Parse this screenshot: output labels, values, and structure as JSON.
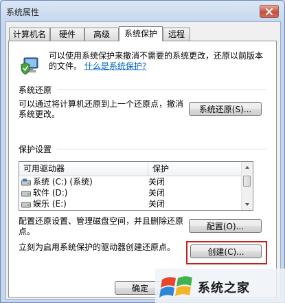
{
  "window": {
    "title": "系统属性"
  },
  "tabs": [
    {
      "label": "计算机名"
    },
    {
      "label": "硬件"
    },
    {
      "label": "高级"
    },
    {
      "label": "系统保护"
    },
    {
      "label": "远程"
    }
  ],
  "intro": {
    "text": "可以使用系统保护来撤消不需要的系统更改，还原以前版本的文件。",
    "link": "什么是系统保护?",
    "icon": "computer-shield-icon"
  },
  "restore": {
    "section": "系统还原",
    "description": "可以通过将计算机还原到上一个还原点，撤消系统更改。",
    "button": "系统还原(S)..."
  },
  "protection": {
    "section": "保护设置",
    "columns": [
      "可用驱动器",
      "保护"
    ],
    "rows": [
      {
        "drive": "系统 (C:) (系统)",
        "status": "关闭",
        "icon": "system-drive-icon"
      },
      {
        "drive": "软件 (D:)",
        "status": "关闭",
        "icon": "drive-icon"
      },
      {
        "drive": "娱乐 (E:)",
        "status": "关闭",
        "icon": "drive-icon"
      }
    ],
    "configure_text": "配置还原设置、管理磁盘空间，并且删除还原点。",
    "configure_button": "配置(O)...",
    "create_text": "立刻为启用系统保护的驱动器创建还原点。",
    "create_button": "创建(C)..."
  },
  "footer": {
    "ok_button": "确定"
  },
  "watermark": {
    "text": "系统之家"
  },
  "colors": {
    "link": "#0066cc",
    "highlight": "#c0221b",
    "accent": "#1e66c9"
  }
}
